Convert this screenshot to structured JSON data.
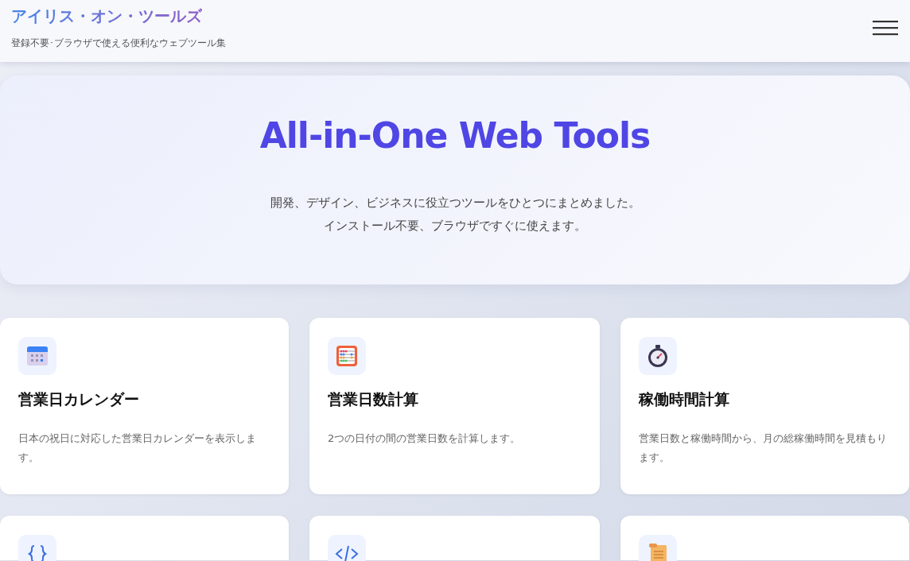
{
  "header": {
    "site_title": "アイリス・オン・ツールズ",
    "tagline": "登録不要･ブラウザで使える便利なウェブツール集"
  },
  "hero": {
    "title": "All-in-One Web Tools",
    "lines": [
      "開発、デザイン、ビジネスに役立つツールをひとつにまとめました。",
      "インストール不要、ブラウザですぐに使えます。"
    ]
  },
  "tools": [
    {
      "kind": "text",
      "title": "営業日カレンダー",
      "description": "日本の祝日に対応した営業日カレンダーを表示します。"
    },
    {
      "kind": "text",
      "title": "営業日数計算",
      "description": "2つの日付の間の営業日数を計算します。"
    },
    {
      "kind": "text",
      "title": "稼働時間計算",
      "description": "営業日数と稼働時間から、月の総稼働時間を見積もります。"
    },
    {
      "kind": "cut"
    },
    {
      "kind": "cut"
    },
    {
      "kind": "cut"
    }
  ]
}
